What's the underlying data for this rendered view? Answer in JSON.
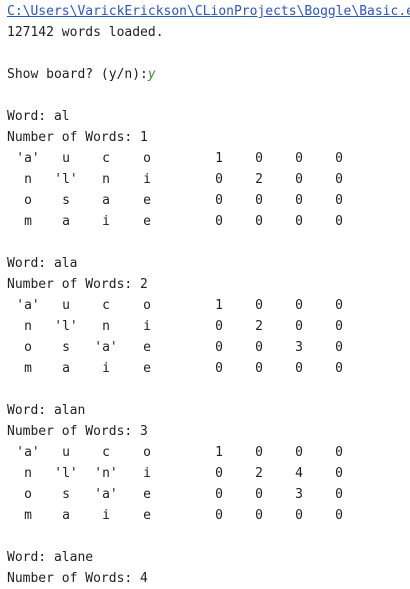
{
  "console": {
    "path_line": "C:\\Users\\VarickErickson\\CLionProjects\\Boggle\\Basic.exe",
    "loaded_line": "127142 words loaded.",
    "prompt": "Show board? (y/n):",
    "prompt_answer": "y"
  },
  "blocks": [
    {
      "word_line": "Word: al",
      "count_line": "Number of Words: 1",
      "board": [
        [
          "'a'",
          "u",
          "c",
          "o"
        ],
        [
          "n",
          "'l'",
          "n",
          "i"
        ],
        [
          "o",
          "s",
          "a",
          "e"
        ],
        [
          "m",
          "a",
          "i",
          "e"
        ]
      ],
      "visited": [
        [
          "1",
          "0",
          "0",
          "0"
        ],
        [
          "0",
          "2",
          "0",
          "0"
        ],
        [
          "0",
          "0",
          "0",
          "0"
        ],
        [
          "0",
          "0",
          "0",
          "0"
        ]
      ]
    },
    {
      "word_line": "Word: ala",
      "count_line": "Number of Words: 2",
      "board": [
        [
          "'a'",
          "u",
          "c",
          "o"
        ],
        [
          "n",
          "'l'",
          "n",
          "i"
        ],
        [
          "o",
          "s",
          "'a'",
          "e"
        ],
        [
          "m",
          "a",
          "i",
          "e"
        ]
      ],
      "visited": [
        [
          "1",
          "0",
          "0",
          "0"
        ],
        [
          "0",
          "2",
          "0",
          "0"
        ],
        [
          "0",
          "0",
          "3",
          "0"
        ],
        [
          "0",
          "0",
          "0",
          "0"
        ]
      ]
    },
    {
      "word_line": "Word: alan",
      "count_line": "Number of Words: 3",
      "board": [
        [
          "'a'",
          "u",
          "c",
          "o"
        ],
        [
          "n",
          "'l'",
          "'n'",
          "i"
        ],
        [
          "o",
          "s",
          "'a'",
          "e"
        ],
        [
          "m",
          "a",
          "i",
          "e"
        ]
      ],
      "visited": [
        [
          "1",
          "0",
          "0",
          "0"
        ],
        [
          "0",
          "2",
          "4",
          "0"
        ],
        [
          "0",
          "0",
          "3",
          "0"
        ],
        [
          "0",
          "0",
          "0",
          "0"
        ]
      ]
    }
  ],
  "trailing": {
    "word_line": "Word: alane",
    "count_line": "Number of Words: 4"
  }
}
